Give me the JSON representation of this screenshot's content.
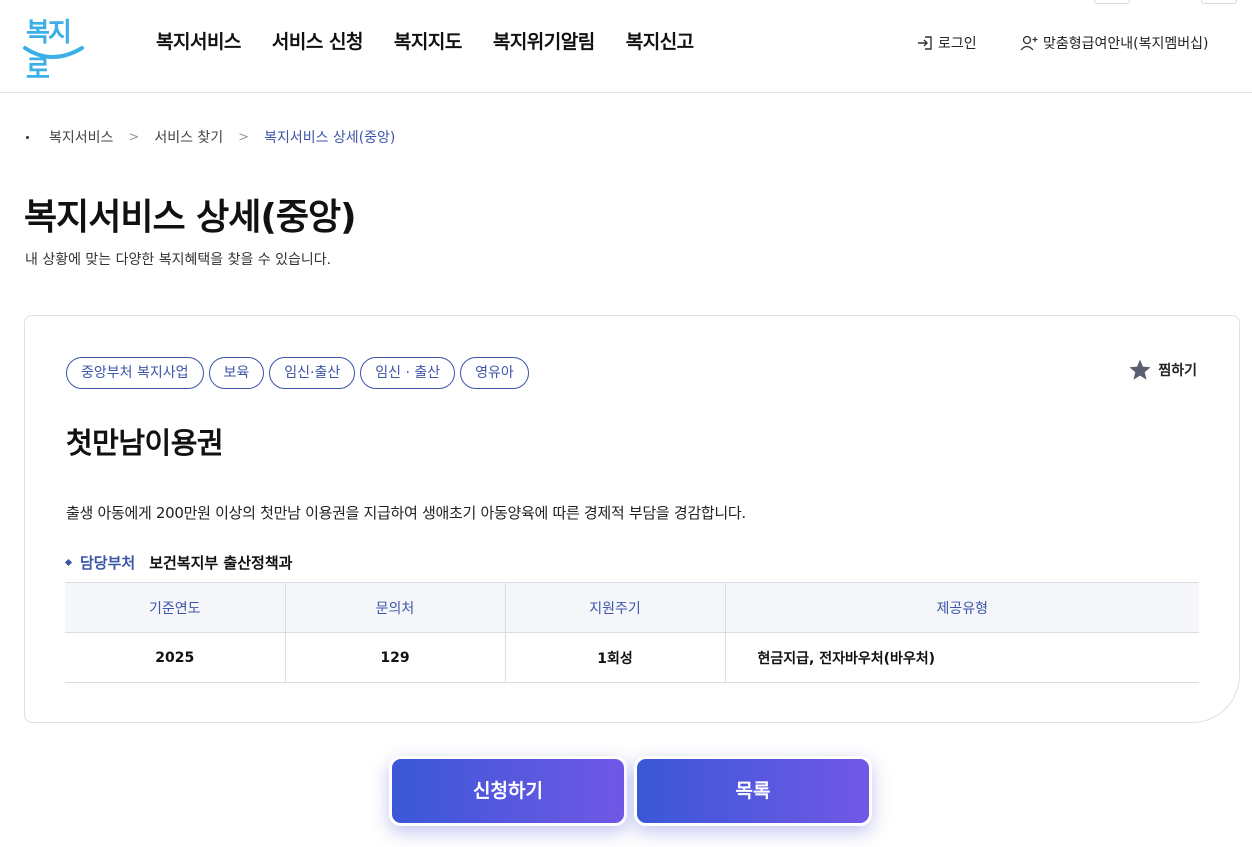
{
  "header": {
    "logo_text": "복지로",
    "nav": [
      "복지서비스",
      "서비스 신청",
      "복지지도",
      "복지위기알림",
      "복지신고"
    ],
    "login_label": "로그인",
    "member_label": "맞춤형급여안내(복지멤버십)"
  },
  "breadcrumb": [
    "복지서비스",
    "서비스 찾기",
    "복지서비스 상세(중앙)"
  ],
  "page": {
    "title": "복지서비스 상세(중앙)",
    "description": "내 상황에 맞는 다양한 복지혜택을 찾을 수 있습니다."
  },
  "service": {
    "tags": [
      "중앙부처 복지사업",
      "보육",
      "임신·출산",
      "임신 · 출산",
      "영유아"
    ],
    "favorite_label": "찜하기",
    "title": "첫만남이용권",
    "description": "출생 아동에게 200만원 이상의 첫만남 이용권을 지급하여 생애초기 아동양육에 따른 경제적 부담을 경감합니다.",
    "dept_label": "담당부처",
    "dept_value": "보건복지부 출산정책과",
    "table": {
      "headers": [
        "기준연도",
        "문의처",
        "지원주기",
        "제공유형"
      ],
      "row": [
        "2025",
        "129",
        "1회성",
        "현금지급, 전자바우처(바우처)"
      ]
    }
  },
  "actions": {
    "apply_label": "신청하기",
    "list_label": "목록"
  },
  "colors": {
    "accent": "#3d55a8",
    "logo": "#3bb0e6",
    "button_gradient_start": "#3a58d6",
    "button_gradient_end": "#7158e6"
  },
  "icons": {
    "login": "login-icon",
    "member": "user-plus-icon",
    "favorite": "star-icon"
  }
}
